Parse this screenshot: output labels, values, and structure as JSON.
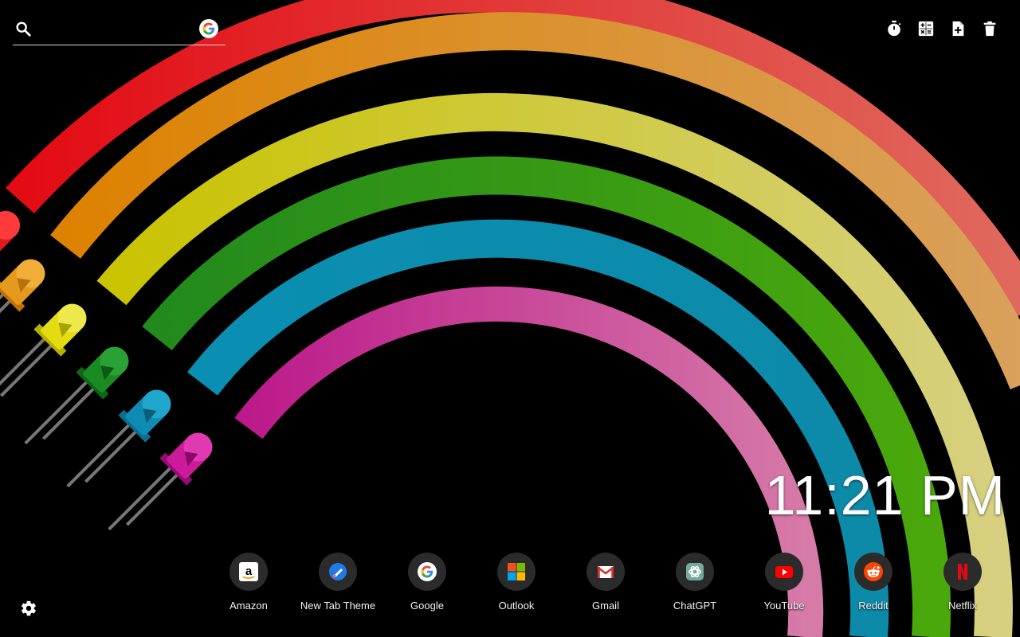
{
  "search": {
    "value": "",
    "placeholder": "",
    "icon": "search-icon",
    "engine_icon": "google-logo-icon"
  },
  "toolbar": {
    "items": [
      {
        "icon": "stopwatch-icon"
      },
      {
        "icon": "calculator-icon"
      },
      {
        "icon": "add-note-icon"
      },
      {
        "icon": "trash-icon"
      }
    ]
  },
  "clock": {
    "time": "11:21 PM"
  },
  "shortcuts": [
    {
      "label": "Amazon",
      "icon": "amazon-icon"
    },
    {
      "label": "New Tab Theme",
      "icon": "new-tab-theme-icon"
    },
    {
      "label": "Google",
      "icon": "google-icon"
    },
    {
      "label": "Outlook",
      "icon": "microsoft-icon"
    },
    {
      "label": "Gmail",
      "icon": "gmail-icon"
    },
    {
      "label": "ChatGPT",
      "icon": "chatgpt-icon"
    },
    {
      "label": "YouTube",
      "icon": "youtube-icon"
    },
    {
      "label": "Reddit",
      "icon": "reddit-icon"
    },
    {
      "label": "Netflix",
      "icon": "netflix-icon"
    }
  ],
  "settings": {
    "icon": "gear-icon"
  },
  "colors": {
    "background": "#000000",
    "rainbow": [
      "#e0161b",
      "#dd8a1f",
      "#cdd050",
      "#3a9a16",
      "#1194b4",
      "#c0549c"
    ]
  }
}
